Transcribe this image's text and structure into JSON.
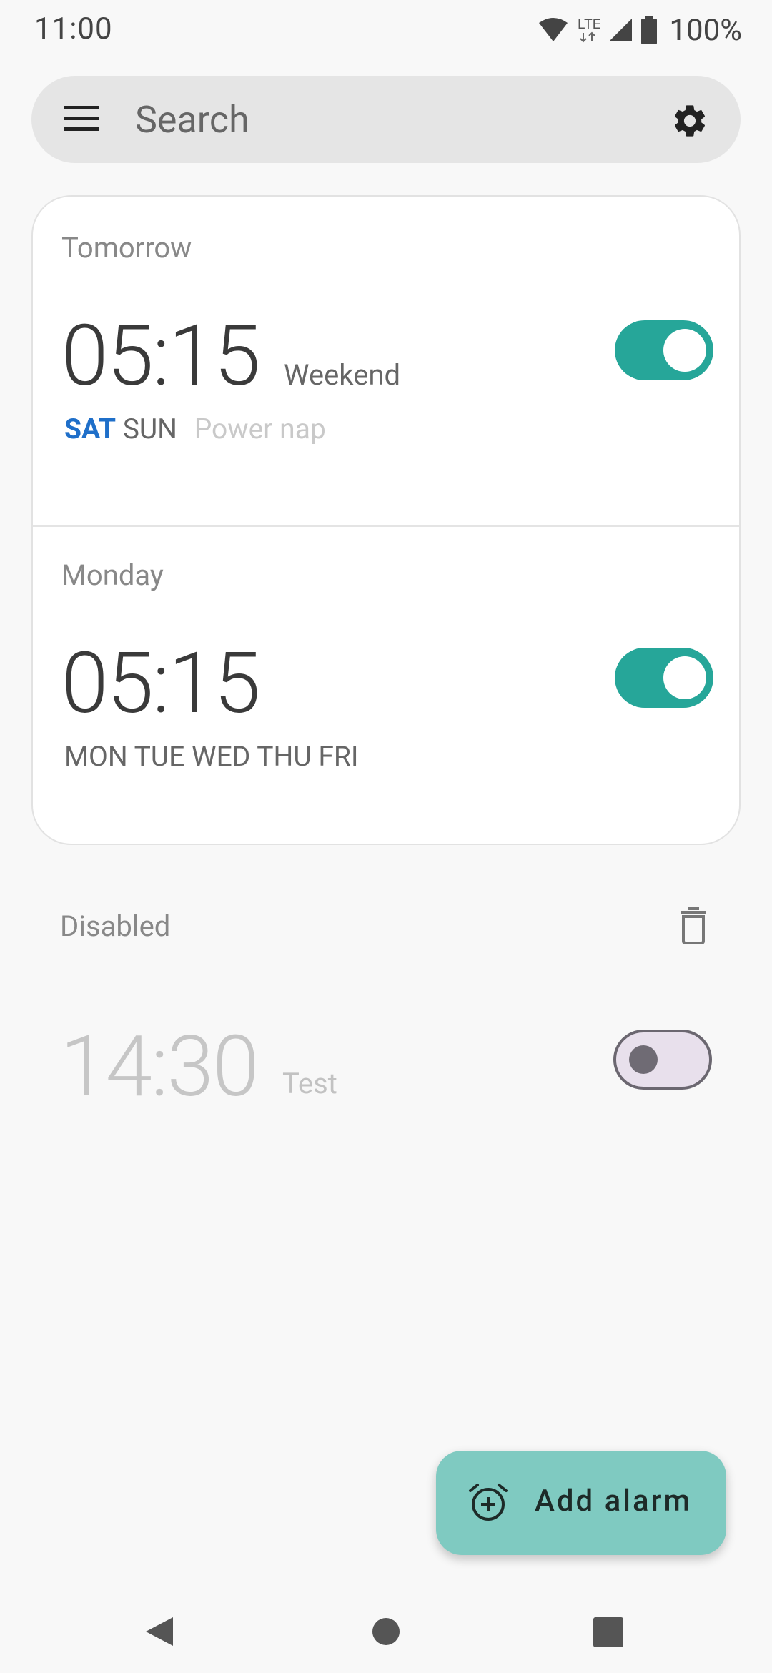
{
  "status_bar": {
    "time": "11:00",
    "network": "LTE",
    "battery": "100%",
    "icons": [
      "wifi-icon",
      "lte-icon",
      "signal-icon",
      "battery-icon"
    ]
  },
  "search": {
    "placeholder": "Search",
    "menu_icon": "menu-icon",
    "settings_icon": "gear-icon"
  },
  "alarms": [
    {
      "label": "Tomorrow",
      "time": "05:15",
      "name": "Weekend",
      "days_active": "SAT",
      "days": "SUN",
      "note": "Power nap",
      "enabled": true
    },
    {
      "label": "Monday",
      "time": "05:15",
      "name": "",
      "days": "MON TUE WED THU FRI",
      "enabled": true
    }
  ],
  "disabled_section": {
    "header": "Disabled",
    "delete_icon": "trash-icon",
    "alarms": [
      {
        "time": "14:30",
        "name": "Test",
        "enabled": false
      }
    ]
  },
  "fab": {
    "label": "Add alarm",
    "icon": "alarm-add-icon"
  },
  "navigation": [
    "back-icon",
    "home-icon",
    "recents-icon"
  ],
  "colors": {
    "accent": "#26a699",
    "fab": "#7fcac1",
    "active_day": "#1f6fc9",
    "background": "#f8f8f8"
  }
}
